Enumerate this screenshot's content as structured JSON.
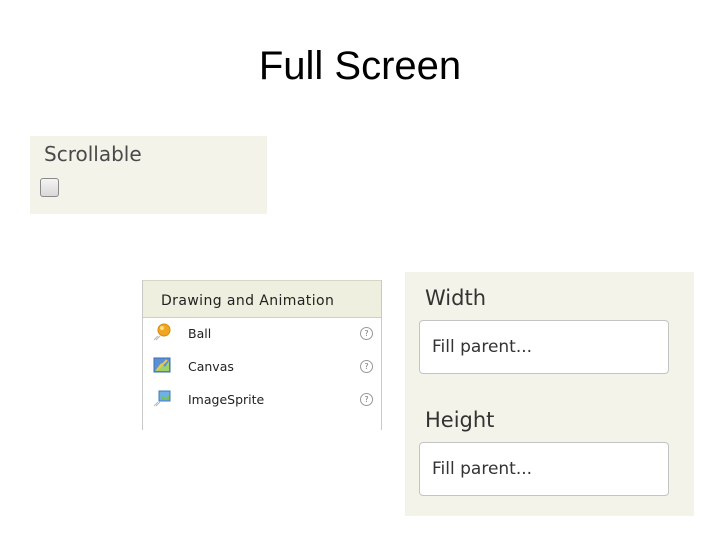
{
  "slide": {
    "title": "Full Screen"
  },
  "scrollable": {
    "label": "Scrollable",
    "checked": false
  },
  "palette": {
    "header": "Drawing and Animation",
    "items": [
      {
        "label": "Ball",
        "icon": "ball-icon",
        "help": "?"
      },
      {
        "label": "Canvas",
        "icon": "canvas-icon",
        "help": "?"
      },
      {
        "label": "ImageSprite",
        "icon": "imagesprite-icon",
        "help": "?"
      }
    ]
  },
  "properties": {
    "width": {
      "label": "Width",
      "value": "Fill parent..."
    },
    "height": {
      "label": "Height",
      "value": "Fill parent..."
    }
  },
  "colors": {
    "panel_bg": "#f3f3ea",
    "palette_header_bg": "#efefdf"
  }
}
